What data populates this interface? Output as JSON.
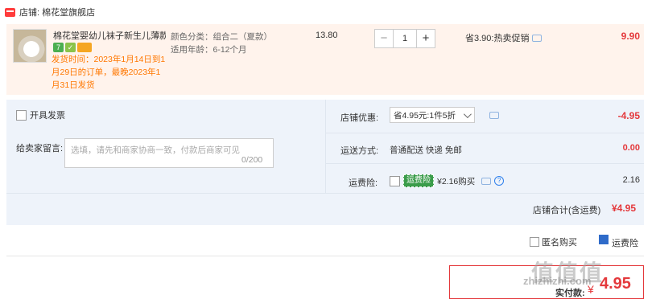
{
  "store": {
    "label": "店铺:  棉花堂旗舰店",
    "icon": "shop-icon"
  },
  "item": {
    "title": "棉花堂婴幼儿袜子新生儿薄款宝...",
    "badges": [
      "7",
      "✓",
      ""
    ],
    "shipping_note": "发货时间：2023年1月14日到1月29日的订单，最晚2023年1月31日发货",
    "sku": {
      "color": "颜色分类：组合二（夏款）",
      "age": "适用年龄：6-12个月"
    },
    "unit_price": "13.80",
    "quantity": "1",
    "promo": "省3.90:热卖促销",
    "subtotal": "9.90"
  },
  "options": {
    "invoice_label": "开具发票",
    "note_label": "给卖家留言:",
    "note_placeholder": "选填，请先和商家协商一致，付款后商家可见",
    "note_count": "0/200",
    "coupon_label": "店铺优惠:",
    "coupon_value": "省4.95元:1件5折",
    "coupon_amount": "-4.95",
    "shipping_label": "运送方式:",
    "shipping_value": "普通配送 快递 免邮",
    "shipping_fee": "0.00",
    "insurance_label": "运费险:",
    "insurance_tag": "运费险",
    "insurance_text": "¥2.16购买",
    "insurance_amount": "2.16",
    "total_label": "店铺合计(含运费)",
    "total_value": "¥4.95"
  },
  "bottom": {
    "anon_label": "匿名购买",
    "pay_text": "运费险",
    "pay_label": "实付款:",
    "pay_currency": "¥",
    "pay_amount": "4.95",
    "watermark": "值值值",
    "watermark_sub": "zhizhizhi.com"
  },
  "colors": {
    "accent": "#e4393c",
    "orange": "#ff7700",
    "item_bg": "#fff3ec",
    "section_bg": "#eef3fa"
  }
}
